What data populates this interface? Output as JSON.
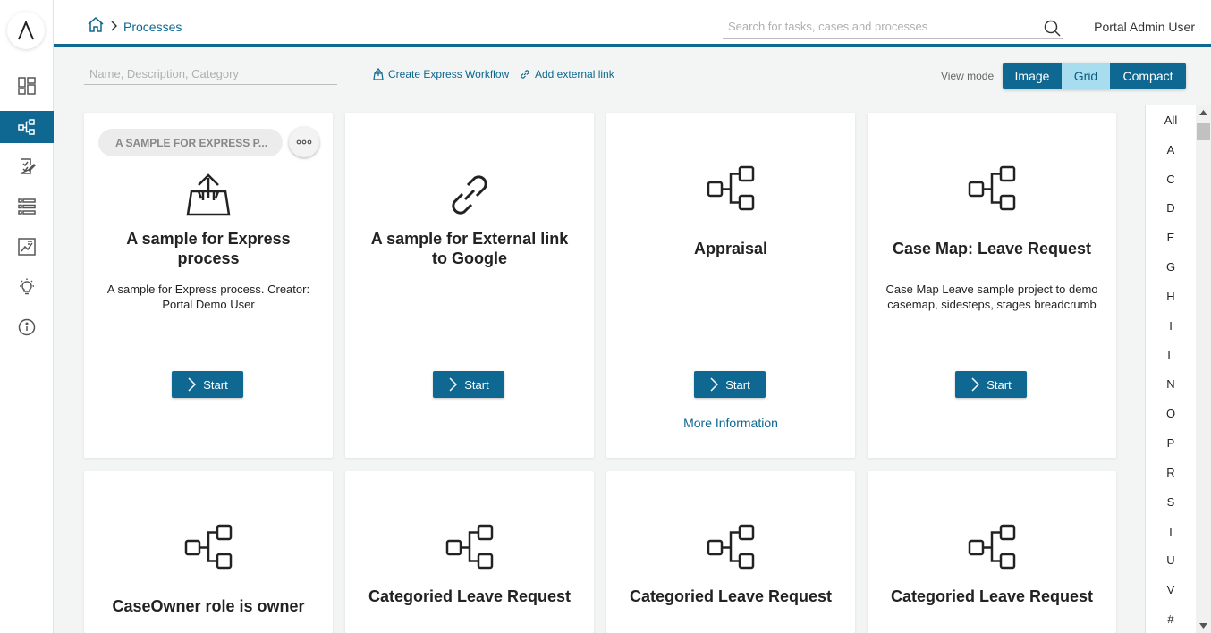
{
  "header": {
    "breadcrumb": "Processes",
    "search_placeholder": "Search for tasks, cases and processes",
    "user_name": "Portal Admin User"
  },
  "toolbar": {
    "filter_placeholder": "Name, Description, Category",
    "create_express": "Create Express Workflow",
    "add_external": "Add external link",
    "view_mode_label": "View mode",
    "view_modes": [
      "Image",
      "Grid",
      "Compact"
    ],
    "selected_view_mode": "Grid"
  },
  "colors": {
    "primary": "#0e6891",
    "selected": "#a8dcef"
  },
  "cards": [
    {
      "category": "A SAMPLE FOR EXPRESS P...",
      "icon": "express-workflow-icon",
      "title": "A sample for Express process",
      "description": "A sample for Express process. Creator: Portal Demo User",
      "start_label": "Start",
      "more_info": ""
    },
    {
      "category": "",
      "icon": "link-icon",
      "title": "A sample for External link to Google",
      "description": "",
      "start_label": "Start",
      "more_info": ""
    },
    {
      "category": "",
      "icon": "process-icon",
      "title": "Appraisal",
      "description": "",
      "start_label": "Start",
      "more_info": "More Information"
    },
    {
      "category": "",
      "icon": "process-icon",
      "title": "Case Map: Leave Request",
      "description": "Case Map Leave sample project to demo casemap, sidesteps, stages breadcrumb",
      "start_label": "Start",
      "more_info": ""
    },
    {
      "category": "",
      "icon": "process-icon",
      "title": "CaseOwner role is owner",
      "description": "",
      "start_label": "",
      "more_info": ""
    },
    {
      "category": "",
      "icon": "process-icon",
      "title": "Categoried Leave Request",
      "description": "",
      "start_label": "",
      "more_info": ""
    },
    {
      "category": "",
      "icon": "process-icon",
      "title": "Categoried Leave Request",
      "description": "",
      "start_label": "",
      "more_info": ""
    },
    {
      "category": "",
      "icon": "process-icon",
      "title": "Categoried Leave Request",
      "description": "",
      "start_label": "",
      "more_info": ""
    }
  ],
  "alphabet": [
    "All",
    "A",
    "C",
    "D",
    "E",
    "G",
    "H",
    "I",
    "L",
    "N",
    "O",
    "P",
    "R",
    "S",
    "T",
    "U",
    "V",
    "#"
  ],
  "sidebar_icons": [
    "dashboard-icon",
    "processes-icon",
    "tasks-icon",
    "cases-icon",
    "statistics-icon",
    "idea-icon",
    "info-icon"
  ]
}
